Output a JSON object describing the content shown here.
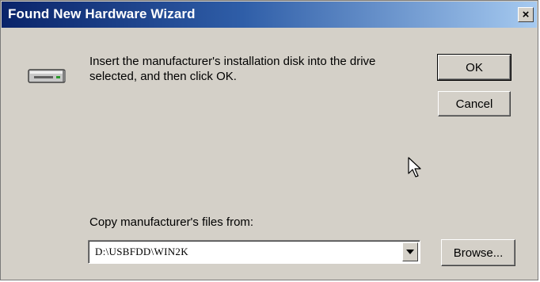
{
  "window": {
    "title": "Found New Hardware Wizard",
    "close_glyph": "×"
  },
  "message": {
    "line1": "Insert the manufacturer's installation disk into the drive",
    "line2": "selected, and then click OK."
  },
  "buttons": {
    "ok_label": "OK",
    "cancel_label": "Cancel",
    "browse_label": "Browse..."
  },
  "copy_from": {
    "label": "Copy manufacturer's files from:",
    "value": "D:\\USBFDD\\WIN2K"
  },
  "icons": {
    "disk": "floppy-drive-icon",
    "dropdown": "dropdown-arrow-icon",
    "cursor": "mouse-pointer-icon",
    "close": "close-icon"
  },
  "colors": {
    "titlebar_start": "#0a246a",
    "titlebar_end": "#a6caf0",
    "dialog_face": "#d4d0c8"
  }
}
